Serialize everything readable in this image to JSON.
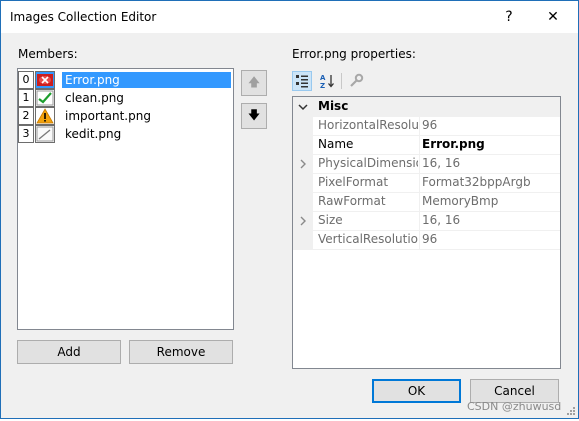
{
  "window": {
    "title": "Images Collection Editor",
    "help_glyph": "?",
    "close_glyph": "✕"
  },
  "members": {
    "label": "Members:",
    "items": [
      {
        "index": "0",
        "name": "Error.png",
        "icon": "error-image-icon",
        "selected": true
      },
      {
        "index": "1",
        "name": "clean.png",
        "icon": "checkmark-image-icon",
        "selected": false
      },
      {
        "index": "2",
        "name": "important.png",
        "icon": "warning-image-icon",
        "selected": false
      },
      {
        "index": "3",
        "name": "kedit.png",
        "icon": "edit-image-icon",
        "selected": false
      }
    ],
    "move_up": "🡅",
    "move_down": "🡇",
    "add_label": "Add",
    "remove_label": "Remove"
  },
  "properties": {
    "label": "Error.png properties:",
    "toolbar_icons": [
      "categorized-view-icon",
      "alphabetical-sort-icon",
      "property-pages-icon"
    ],
    "category": "Misc",
    "rows": [
      {
        "name": "HorizontalResolution",
        "value": "96",
        "expandable": false,
        "emphasis": false
      },
      {
        "name": "Name",
        "value": "Error.png",
        "expandable": false,
        "emphasis": true
      },
      {
        "name": "PhysicalDimension",
        "value": "16, 16",
        "expandable": true,
        "emphasis": false
      },
      {
        "name": "PixelFormat",
        "value": "Format32bppArgb",
        "expandable": false,
        "emphasis": false
      },
      {
        "name": "RawFormat",
        "value": "MemoryBmp",
        "expandable": false,
        "emphasis": false
      },
      {
        "name": "Size",
        "value": "16, 16",
        "expandable": true,
        "emphasis": false
      },
      {
        "name": "VerticalResolution",
        "value": "96",
        "expandable": false,
        "emphasis": false
      }
    ]
  },
  "footer": {
    "ok_label": "OK",
    "cancel_label": "Cancel"
  },
  "watermark": "CSDN @zhuwusd",
  "colors": {
    "selection": "#3399ff",
    "accent": "#0078d7"
  }
}
